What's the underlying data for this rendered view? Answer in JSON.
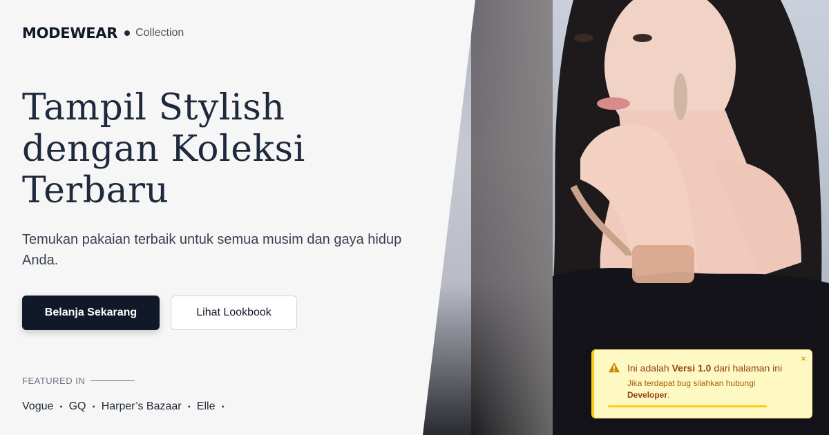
{
  "brand": {
    "name": "MODEWEAR",
    "sub": "Collection"
  },
  "hero": {
    "title_lines": [
      "Tampil Stylish",
      "dengan Koleksi",
      "Terbaru"
    ],
    "subtitle": "Temukan pakaian terbaik untuk semua musim dan gaya hidup Anda."
  },
  "actions": {
    "primary_label": "Belanja Sekarang",
    "secondary_label": "Lihat Lookbook"
  },
  "featured": {
    "label": "FEATURED IN",
    "outlets": [
      "Vogue",
      "GQ",
      "Harper’s Bazaar",
      "Elle"
    ],
    "separator": "•"
  },
  "toast": {
    "title_prefix": "Ini adalah ",
    "title_version": "Versi 1.0",
    "title_suffix": " dari halaman ini",
    "body_prefix": "Jika terdapat bug silahkan hubungi",
    "body_link": "Developer",
    "body_suffix": ".",
    "close_icon": "×",
    "progress": 0.8
  },
  "colors": {
    "primary": "#111827",
    "toast_bg": "#fef9c3",
    "toast_accent": "#facc15"
  },
  "icons": {
    "toast": "warning-icon",
    "close": "close-icon"
  }
}
